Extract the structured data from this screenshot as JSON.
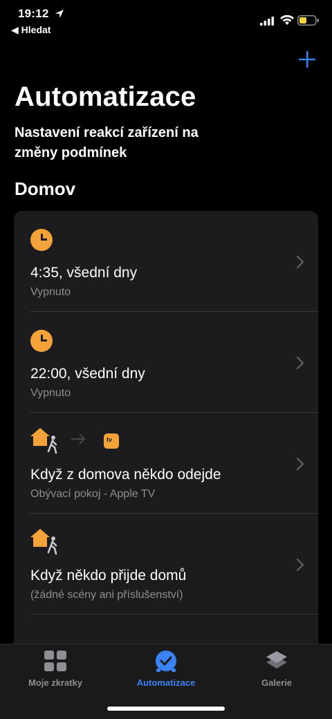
{
  "status_bar": {
    "time": "19:12",
    "back_label": "◀ Hledat"
  },
  "header": {
    "title": "Automatizace",
    "subtitle": "Nastavení reakcí zařízení na změny podmínek",
    "add_icon": "plus-icon"
  },
  "section": {
    "title": "Domov"
  },
  "automations": [
    {
      "icon": "clock-icon",
      "title": "4:35, všední dny",
      "subtitle": "Vypnuto"
    },
    {
      "icon": "clock-icon",
      "title": "22:00, všední dny",
      "subtitle": "Vypnuto"
    },
    {
      "icon": "home-leave-icon",
      "title": "Když z domova někdo odejde",
      "subtitle": "Obývací pokoj - Apple TV",
      "badge": "tv"
    },
    {
      "icon": "home-arrive-icon",
      "title": "Když někdo přijde domů",
      "subtitle": "(žádné scény ani příslušenství)"
    }
  ],
  "tabs": [
    {
      "label": "Moje zkratky",
      "icon": "grid-icon",
      "active": false
    },
    {
      "label": "Automatizace",
      "icon": "clock-check-icon",
      "active": true
    },
    {
      "label": "Galerie",
      "icon": "layers-icon",
      "active": false
    }
  ],
  "colors": {
    "accent": "#3b82f6",
    "icon_orange": "#f3a33a",
    "secondary_text": "#8e8e93",
    "card": "#1c1c1e"
  }
}
